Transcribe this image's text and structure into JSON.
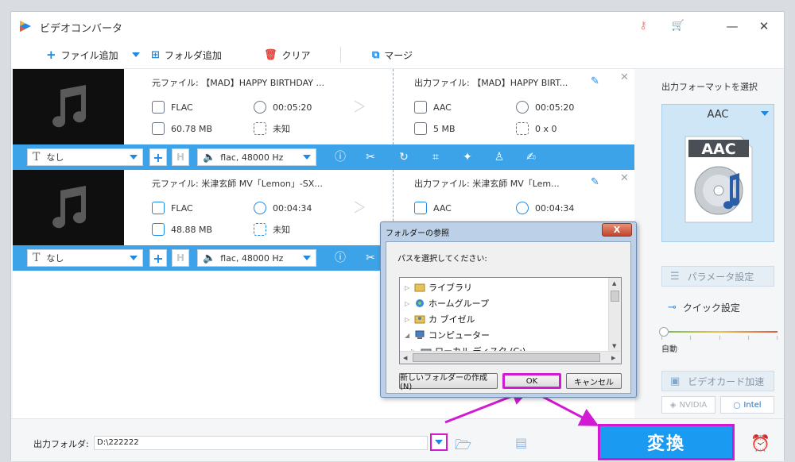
{
  "window": {
    "title": "ビデオコンバータ"
  },
  "toolbar": {
    "add_file": "ファイル追加",
    "add_folder": "フォルダ追加",
    "clear": "クリア",
    "merge": "マージ"
  },
  "items": [
    {
      "source_title": "元ファイル: 【MAD】HAPPY BIRTHDAY ...",
      "output_title": "出力ファイル: 【MAD】HAPPY BIRT...",
      "src_format": "FLAC",
      "src_duration": "00:05:20",
      "src_size": "60.78 MB",
      "src_resolution": "未知",
      "out_format": "AAC",
      "out_duration": "00:05:20",
      "out_size": "5 MB",
      "out_resolution": "0 x 0",
      "subtitle": "なし",
      "audio": "flac, 48000 Hz"
    },
    {
      "source_title": "元ファイル: 米津玄師 MV「Lemon」-SX...",
      "output_title": "出力ファイル: 米津玄師 MV「Lem...",
      "src_format": "FLAC",
      "src_duration": "00:04:34",
      "src_size": "48.88 MB",
      "src_resolution": "未知",
      "out_format": "AAC",
      "out_duration": "00:04:34",
      "subtitle": "なし",
      "audio": "flac, 48000 Hz"
    }
  ],
  "right_panel": {
    "format_label": "出力フォーマットを選択",
    "format_name": "AAC",
    "format_icon_text": "AAC",
    "param_settings": "パラメータ設定",
    "quick_settings": "クイック設定",
    "auto_label": "自動",
    "gpu_accel": "ビデオカード加速",
    "nvidia": "NVIDIA",
    "intel": "Intel"
  },
  "bottom": {
    "output_folder_label": "出力フォルダ:",
    "output_path": "D:\\222222",
    "convert_label": "変換"
  },
  "dialog": {
    "title": "フォルダーの参照",
    "close": "X",
    "prompt": "パスを選択してください:",
    "tree": [
      {
        "label": "ライブラリ",
        "expander": "▷"
      },
      {
        "label": "ホームグループ",
        "expander": "▷"
      },
      {
        "label": "カ ブイゼル",
        "expander": "▷"
      },
      {
        "label": "コンピューター",
        "expander": "◢"
      },
      {
        "label": "ローカル ディスク (C:)",
        "expander": "▷"
      }
    ],
    "new_folder": "新しいフォルダーの作成(N)",
    "ok": "OK",
    "cancel": "キャンセル"
  },
  "colors": {
    "accent": "#1e88e5",
    "toolbar_blue": "#3ca3e9",
    "convert_blue": "#1a9af0",
    "highlight_magenta": "#d21ad2"
  }
}
